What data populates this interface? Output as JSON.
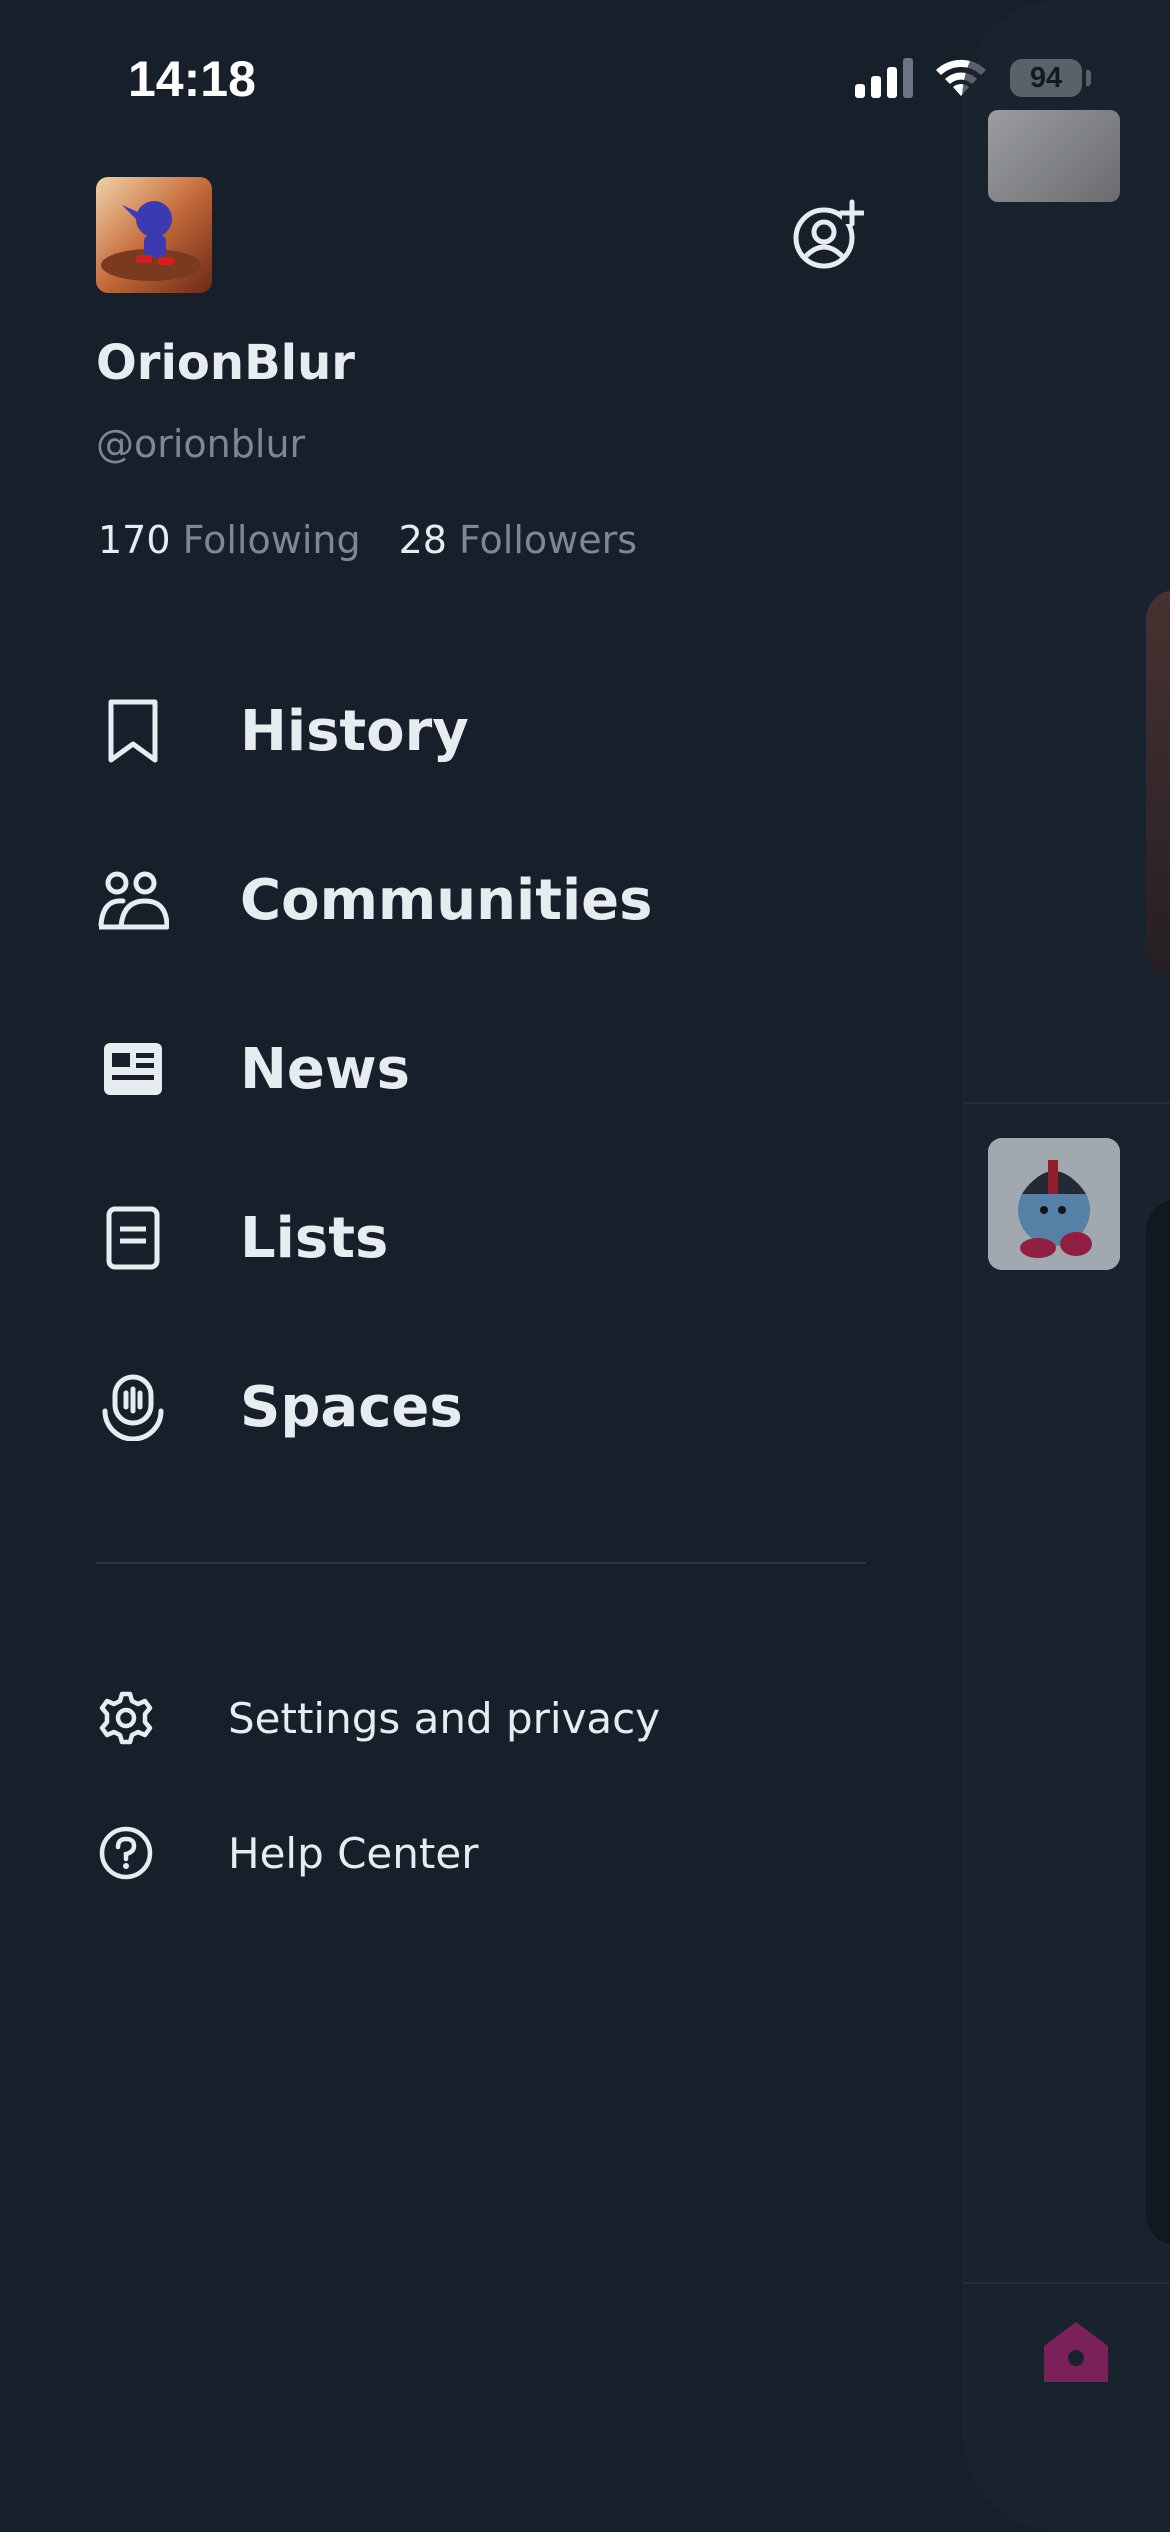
{
  "status_bar": {
    "time": "14:18",
    "battery": "94"
  },
  "profile": {
    "display_name": "OrionBlur",
    "handle": "@orionblur",
    "following_count": "170",
    "following_label": "Following",
    "followers_count": "28",
    "followers_label": "Followers"
  },
  "nav": {
    "items": [
      {
        "label": "History",
        "icon": "bookmark-icon"
      },
      {
        "label": "Communities",
        "icon": "communities-icon"
      },
      {
        "label": "News",
        "icon": "news-icon"
      },
      {
        "label": "Lists",
        "icon": "lists-icon"
      },
      {
        "label": "Spaces",
        "icon": "spaces-icon"
      }
    ]
  },
  "secondary": {
    "items": [
      {
        "label": "Settings and privacy",
        "icon": "gear-icon"
      },
      {
        "label": "Help Center",
        "icon": "help-icon"
      }
    ]
  },
  "colors": {
    "background": "#161f2a",
    "text": "#e7ecf0",
    "muted": "#7d8894",
    "home_accent": "#a0226a"
  }
}
